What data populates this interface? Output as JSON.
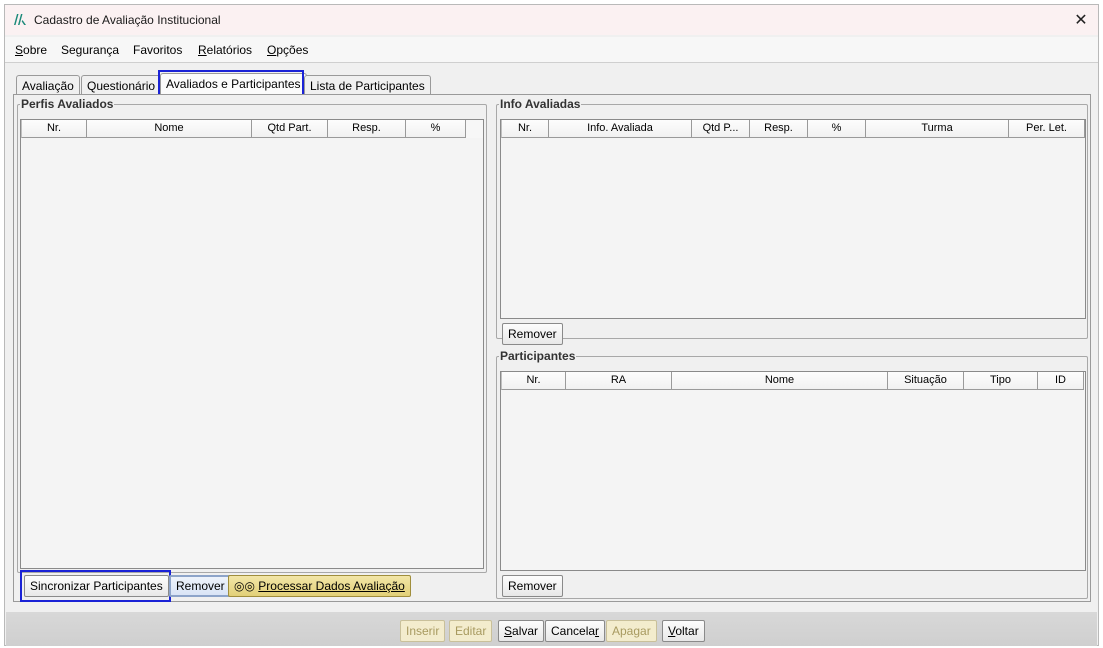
{
  "window": {
    "title": "Cadastro de Avaliação Institucional",
    "close_glyph": "✕"
  },
  "menu": [
    {
      "label_mn": "S",
      "label_rest": "obre"
    },
    {
      "label_mn": "",
      "label_rest": "Segurança"
    },
    {
      "label_mn": "",
      "label_rest": "Favoritos"
    },
    {
      "label_mn": "R",
      "label_rest": "elatórios"
    },
    {
      "label_mn": "O",
      "label_rest": "pções"
    }
  ],
  "tabs": [
    "Avaliação",
    "Questionário",
    "Avaliados e Participantes",
    "Lista de Participantes"
  ],
  "perfis": {
    "legend": "Perfis Avaliados",
    "columns": [
      "Nr.",
      "Nome",
      "Qtd Part.",
      "Resp.",
      "%"
    ],
    "buttons": {
      "sync": "Sincronizar Participantes",
      "remove": "Remover",
      "process": "Processar Dados Avaliação",
      "process_icon": "◎◎"
    }
  },
  "info": {
    "legend": "Info Avaliadas",
    "columns": [
      "Nr.",
      "Info. Avaliada",
      "Qtd P...",
      "Resp.",
      "%",
      "Turma",
      "Per. Let."
    ],
    "remove": "Remover"
  },
  "participantes": {
    "legend": "Participantes",
    "columns": [
      "Nr.",
      "RA",
      "Nome",
      "Situação",
      "Tipo",
      "ID"
    ],
    "remove": "Remover"
  },
  "footer": {
    "inserir": "Inserir",
    "editar": "Editar",
    "salvar_mn": "S",
    "salvar_rest": "alvar",
    "cancelar_a": "Cancela",
    "cancelar_mn": "r",
    "apagar": "Apagar",
    "voltar_mn": "V",
    "voltar_rest": "oltar"
  }
}
